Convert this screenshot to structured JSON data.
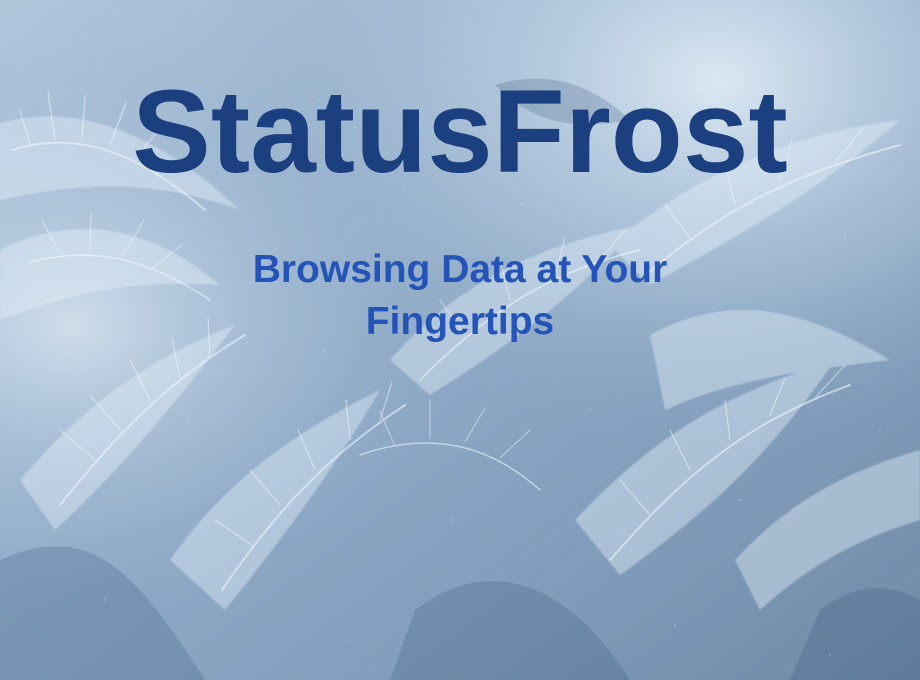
{
  "hero": {
    "title": "StatusFrost",
    "subtitle": "Browsing Data at Your Fingertips"
  },
  "colors": {
    "title": "#1c3f7f",
    "subtitle": "#2454b7",
    "frost_base": "#6d8db1",
    "frost_light": "#c8dbeb",
    "frost_dark": "#375a7c"
  }
}
